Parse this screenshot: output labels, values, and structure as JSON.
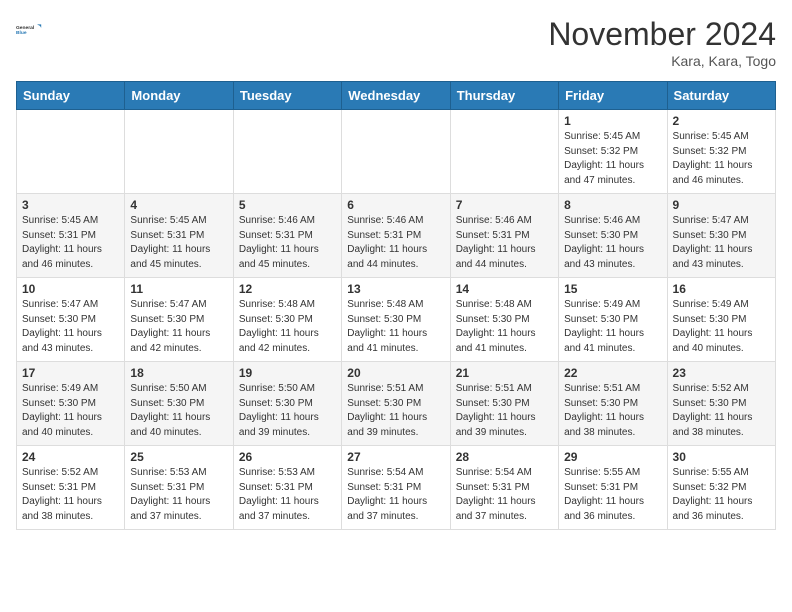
{
  "header": {
    "logo_line1": "General",
    "logo_line2": "Blue",
    "month_title": "November 2024",
    "location": "Kara, Kara, Togo"
  },
  "weekdays": [
    "Sunday",
    "Monday",
    "Tuesday",
    "Wednesday",
    "Thursday",
    "Friday",
    "Saturday"
  ],
  "weeks": [
    [
      {
        "day": "",
        "info": ""
      },
      {
        "day": "",
        "info": ""
      },
      {
        "day": "",
        "info": ""
      },
      {
        "day": "",
        "info": ""
      },
      {
        "day": "",
        "info": ""
      },
      {
        "day": "1",
        "info": "Sunrise: 5:45 AM\nSunset: 5:32 PM\nDaylight: 11 hours and 47 minutes."
      },
      {
        "day": "2",
        "info": "Sunrise: 5:45 AM\nSunset: 5:32 PM\nDaylight: 11 hours and 46 minutes."
      }
    ],
    [
      {
        "day": "3",
        "info": "Sunrise: 5:45 AM\nSunset: 5:31 PM\nDaylight: 11 hours and 46 minutes."
      },
      {
        "day": "4",
        "info": "Sunrise: 5:45 AM\nSunset: 5:31 PM\nDaylight: 11 hours and 45 minutes."
      },
      {
        "day": "5",
        "info": "Sunrise: 5:46 AM\nSunset: 5:31 PM\nDaylight: 11 hours and 45 minutes."
      },
      {
        "day": "6",
        "info": "Sunrise: 5:46 AM\nSunset: 5:31 PM\nDaylight: 11 hours and 44 minutes."
      },
      {
        "day": "7",
        "info": "Sunrise: 5:46 AM\nSunset: 5:31 PM\nDaylight: 11 hours and 44 minutes."
      },
      {
        "day": "8",
        "info": "Sunrise: 5:46 AM\nSunset: 5:30 PM\nDaylight: 11 hours and 43 minutes."
      },
      {
        "day": "9",
        "info": "Sunrise: 5:47 AM\nSunset: 5:30 PM\nDaylight: 11 hours and 43 minutes."
      }
    ],
    [
      {
        "day": "10",
        "info": "Sunrise: 5:47 AM\nSunset: 5:30 PM\nDaylight: 11 hours and 43 minutes."
      },
      {
        "day": "11",
        "info": "Sunrise: 5:47 AM\nSunset: 5:30 PM\nDaylight: 11 hours and 42 minutes."
      },
      {
        "day": "12",
        "info": "Sunrise: 5:48 AM\nSunset: 5:30 PM\nDaylight: 11 hours and 42 minutes."
      },
      {
        "day": "13",
        "info": "Sunrise: 5:48 AM\nSunset: 5:30 PM\nDaylight: 11 hours and 41 minutes."
      },
      {
        "day": "14",
        "info": "Sunrise: 5:48 AM\nSunset: 5:30 PM\nDaylight: 11 hours and 41 minutes."
      },
      {
        "day": "15",
        "info": "Sunrise: 5:49 AM\nSunset: 5:30 PM\nDaylight: 11 hours and 41 minutes."
      },
      {
        "day": "16",
        "info": "Sunrise: 5:49 AM\nSunset: 5:30 PM\nDaylight: 11 hours and 40 minutes."
      }
    ],
    [
      {
        "day": "17",
        "info": "Sunrise: 5:49 AM\nSunset: 5:30 PM\nDaylight: 11 hours and 40 minutes."
      },
      {
        "day": "18",
        "info": "Sunrise: 5:50 AM\nSunset: 5:30 PM\nDaylight: 11 hours and 40 minutes."
      },
      {
        "day": "19",
        "info": "Sunrise: 5:50 AM\nSunset: 5:30 PM\nDaylight: 11 hours and 39 minutes."
      },
      {
        "day": "20",
        "info": "Sunrise: 5:51 AM\nSunset: 5:30 PM\nDaylight: 11 hours and 39 minutes."
      },
      {
        "day": "21",
        "info": "Sunrise: 5:51 AM\nSunset: 5:30 PM\nDaylight: 11 hours and 39 minutes."
      },
      {
        "day": "22",
        "info": "Sunrise: 5:51 AM\nSunset: 5:30 PM\nDaylight: 11 hours and 38 minutes."
      },
      {
        "day": "23",
        "info": "Sunrise: 5:52 AM\nSunset: 5:30 PM\nDaylight: 11 hours and 38 minutes."
      }
    ],
    [
      {
        "day": "24",
        "info": "Sunrise: 5:52 AM\nSunset: 5:31 PM\nDaylight: 11 hours and 38 minutes."
      },
      {
        "day": "25",
        "info": "Sunrise: 5:53 AM\nSunset: 5:31 PM\nDaylight: 11 hours and 37 minutes."
      },
      {
        "day": "26",
        "info": "Sunrise: 5:53 AM\nSunset: 5:31 PM\nDaylight: 11 hours and 37 minutes."
      },
      {
        "day": "27",
        "info": "Sunrise: 5:54 AM\nSunset: 5:31 PM\nDaylight: 11 hours and 37 minutes."
      },
      {
        "day": "28",
        "info": "Sunrise: 5:54 AM\nSunset: 5:31 PM\nDaylight: 11 hours and 37 minutes."
      },
      {
        "day": "29",
        "info": "Sunrise: 5:55 AM\nSunset: 5:31 PM\nDaylight: 11 hours and 36 minutes."
      },
      {
        "day": "30",
        "info": "Sunrise: 5:55 AM\nSunset: 5:32 PM\nDaylight: 11 hours and 36 minutes."
      }
    ]
  ]
}
